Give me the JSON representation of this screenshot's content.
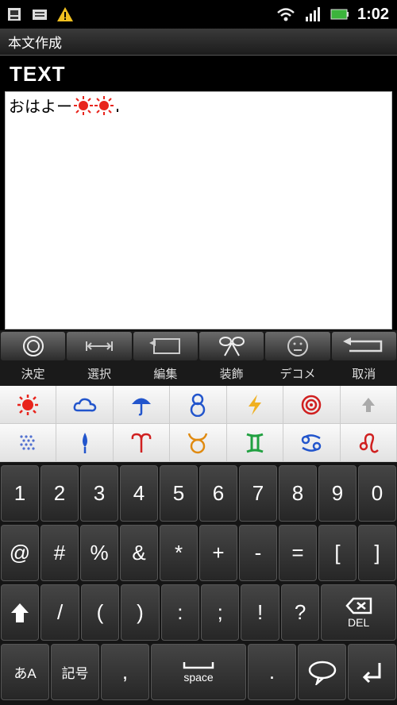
{
  "status": {
    "time": "1:02",
    "icons": [
      "sim-icon",
      "message-icon",
      "warning-icon",
      "wifi-icon",
      "signal-icon",
      "battery-icon"
    ]
  },
  "app": {
    "title": "本文作成"
  },
  "section": {
    "heading": "TEXT"
  },
  "editor": {
    "text": "おはよー",
    "emoji": [
      "sun-emoji",
      "sun-emoji"
    ]
  },
  "toolbar": {
    "buttons": [
      {
        "icon": "confirm-icon",
        "label": "決定"
      },
      {
        "icon": "select-icon",
        "label": "選択"
      },
      {
        "icon": "edit-icon",
        "label": "編集"
      },
      {
        "icon": "decorate-icon",
        "label": "装飾"
      },
      {
        "icon": "decome-icon",
        "label": "デコメ"
      },
      {
        "icon": "cancel-icon",
        "label": "取消"
      }
    ]
  },
  "emoji_palette": {
    "row1": [
      "sun",
      "cloud",
      "umbrella",
      "snowman",
      "lightning",
      "typhoon",
      "scroll-up"
    ],
    "row2": [
      "fog",
      "drizzle",
      "aries",
      "taurus",
      "gemini",
      "cancer",
      "leo"
    ]
  },
  "keyboard": {
    "row1": [
      "1",
      "2",
      "3",
      "4",
      "5",
      "6",
      "7",
      "8",
      "9",
      "0"
    ],
    "row2": [
      "@",
      "#",
      "%",
      "&",
      "*",
      "+",
      "-",
      "=",
      "[",
      "]"
    ],
    "row3": [
      "/",
      "(",
      ")",
      ":",
      ";",
      "!",
      "?"
    ],
    "shift_icon": "shift-icon",
    "del_label": "DEL",
    "mode_label": "あA",
    "symbol_label": "記号",
    "comma": ",",
    "space_label": "space",
    "period": ".",
    "enter_icon": "enter-icon"
  },
  "colors": {
    "sun": "#e8241c",
    "cloud": "#2255cc",
    "umbrella": "#2255cc",
    "lightning": "#f0b020",
    "typhoon": "#d02020",
    "aries": "#d02020",
    "taurus": "#e08a10",
    "gemini": "#20a040",
    "cancer": "#2255cc",
    "leo": "#d02020"
  }
}
